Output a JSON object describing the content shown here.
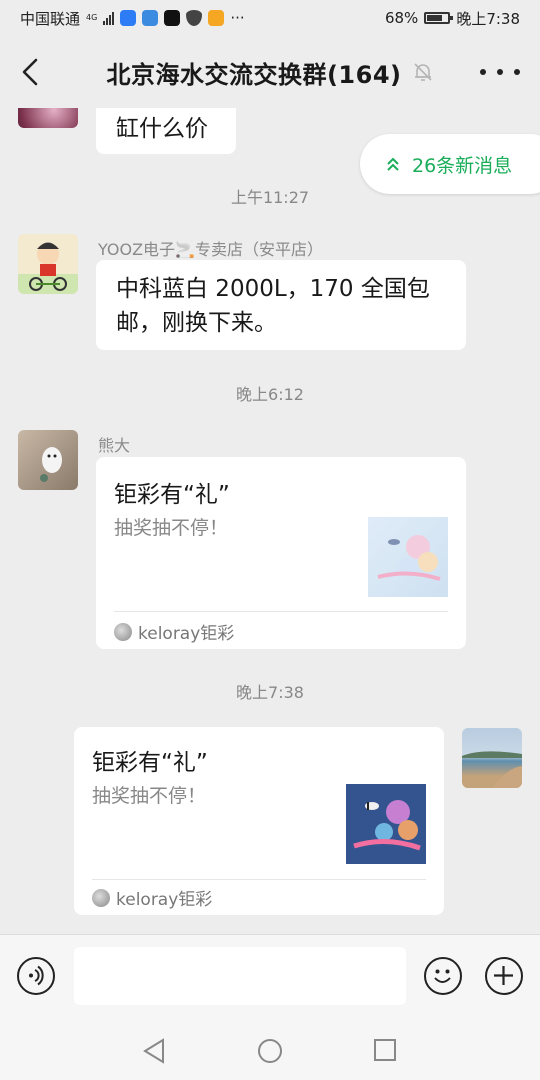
{
  "status_bar": {
    "carrier": "中国联通",
    "network": "4G",
    "battery_percent": "68%",
    "battery_level": 0.68,
    "time": "晚上7:38",
    "more": "···"
  },
  "header": {
    "title": "北京海水交流交换群(164)"
  },
  "new_messages_label": "26条新消息",
  "messages": [
    {
      "type": "text",
      "text": "缸什么价"
    },
    {
      "type": "time",
      "text": "上午11:27"
    },
    {
      "type": "text",
      "sender": "YOOZ电子🚬专卖店（安平店）",
      "text": "中科蓝白 2000L，170 全国包邮，刚换下来。"
    },
    {
      "type": "time",
      "text": "晚上6:12"
    },
    {
      "type": "card",
      "sender": "熊大",
      "title": "钜彩有“礼”",
      "desc": "抽奖抽不停！",
      "source": "keloray钜彩"
    },
    {
      "type": "time",
      "text": "晚上7:38"
    },
    {
      "type": "card",
      "self": true,
      "title": "钜彩有“礼”",
      "desc": "抽奖抽不停！",
      "source": "keloray钜彩"
    }
  ],
  "colors": {
    "background": "#ededed",
    "accent_green": "#1aad5a",
    "bubble": "#ffffff"
  }
}
